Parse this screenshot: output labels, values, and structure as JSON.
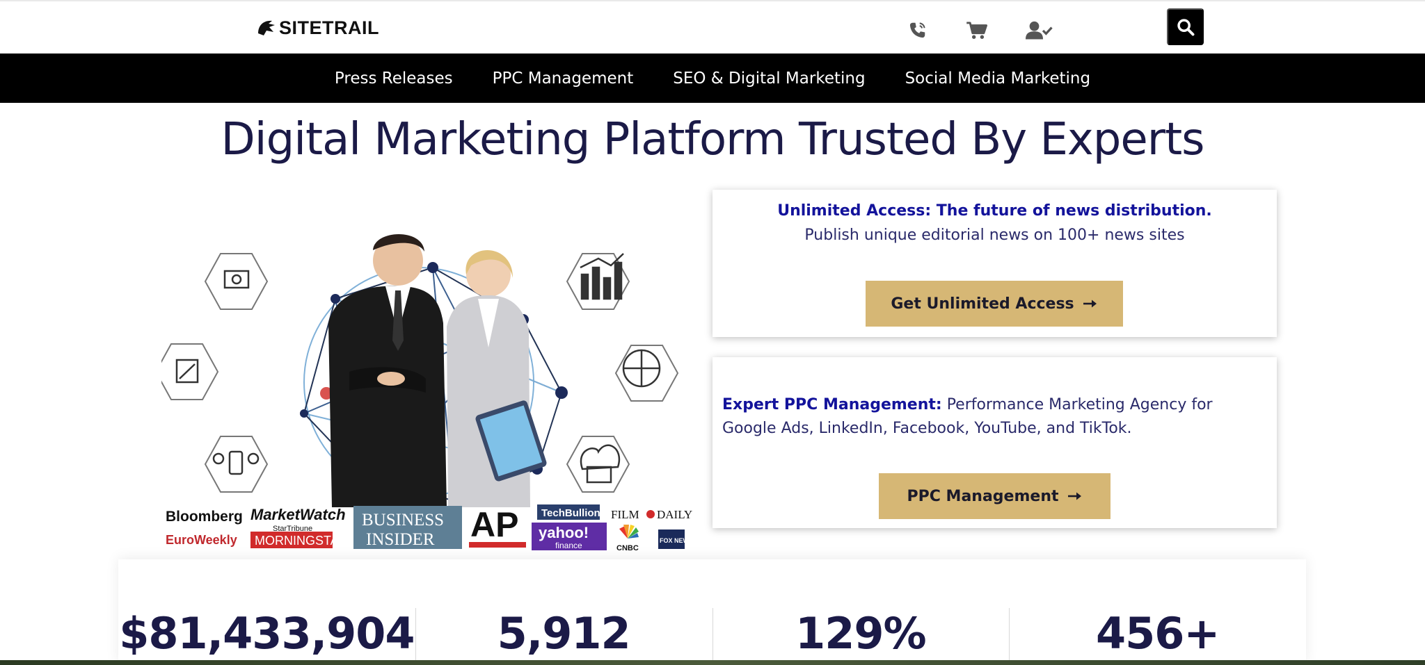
{
  "header": {
    "logo_text": "SITETRAIL",
    "icons": [
      "phone-icon",
      "cart-icon",
      "user-check-icon",
      "search-icon"
    ]
  },
  "nav": {
    "items": [
      {
        "label": "Press Releases"
      },
      {
        "label": "PPC Management"
      },
      {
        "label": "SEO & Digital Marketing"
      },
      {
        "label": "Social Media Marketing"
      }
    ]
  },
  "hero": {
    "title": "Digital Marketing Platform Trusted By Experts"
  },
  "media_logos": [
    "Bloomberg",
    "MarketWatch",
    "StarTribune",
    "EuroWeekly",
    "MORNINGSTAR",
    "BUSINESS",
    "INSIDER",
    "AP",
    "TechBullion",
    "yahoo!",
    "finance",
    "FILM",
    "DAILY",
    "CNBC",
    "FOX NEWS"
  ],
  "cards": {
    "unlimited": {
      "headline": "Unlimited Access: The future of news distribution.",
      "sub": "Publish unique editorial news on 100+ news sites",
      "cta": "Get Unlimited Access"
    },
    "ppc": {
      "bold": "Expert PPC Management:",
      "text": " Performance Marketing Agency for Google Ads, LinkedIn, Facebook, YouTube, and TikTok.",
      "cta": "PPC Management"
    }
  },
  "stats": [
    {
      "value": "$81,433,904"
    },
    {
      "value": "5,912"
    },
    {
      "value": "129%"
    },
    {
      "value": "456+"
    }
  ],
  "colors": {
    "nav_bg": "#000000",
    "title": "#1b1a47",
    "accent_blue": "#13139b",
    "cta_gold": "#d6b775"
  }
}
